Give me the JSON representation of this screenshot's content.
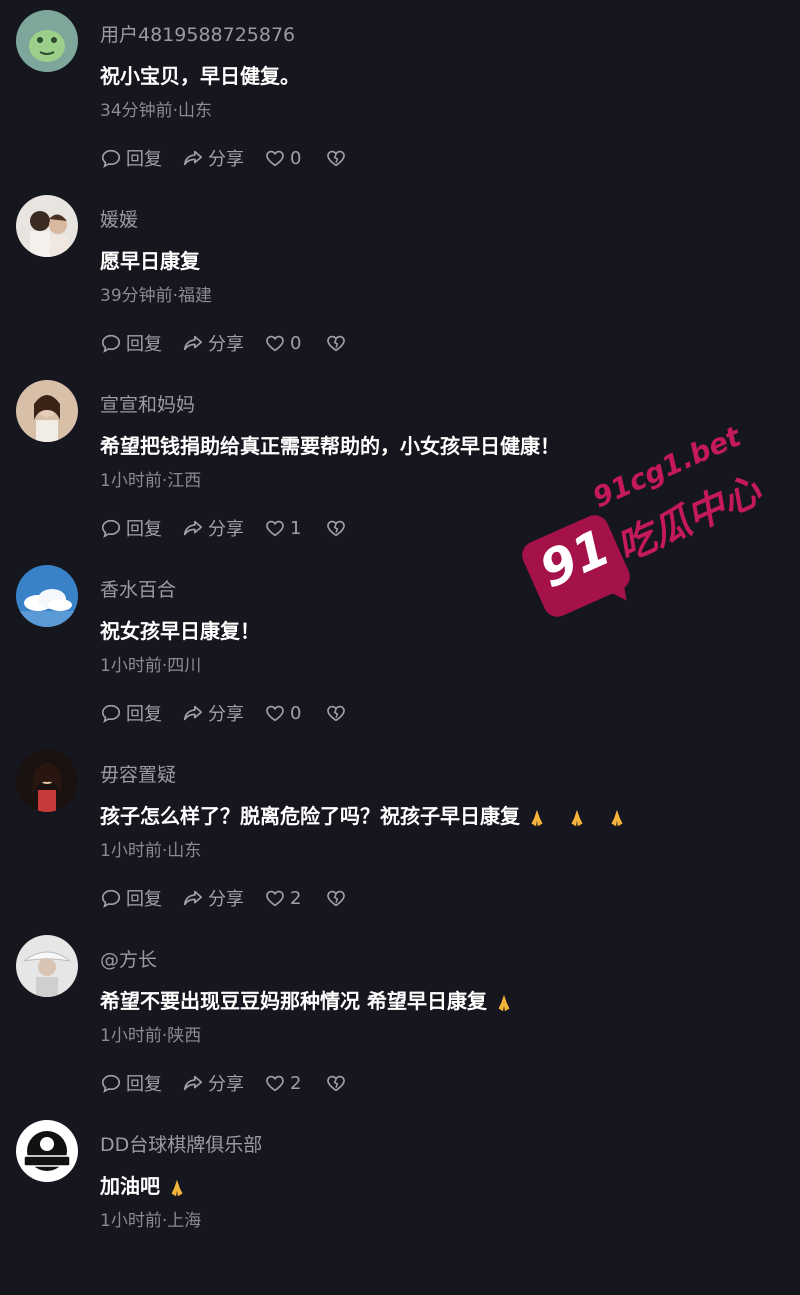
{
  "actions": {
    "reply_label": "回复",
    "share_label": "分享"
  },
  "comments": [
    {
      "user": "用户4819588725876",
      "text": "祝小宝贝，早日健复。",
      "meta": "34分钟前·山东",
      "likes": "0",
      "emojis": 0
    },
    {
      "user": "媛媛",
      "text": "愿早日康复",
      "meta": "39分钟前·福建",
      "likes": "0",
      "emojis": 0
    },
    {
      "user": "宣宣和妈妈",
      "text": "希望把钱捐助给真正需要帮助的，小女孩早日健康！",
      "meta": "1小时前·江西",
      "likes": "1",
      "emojis": 0
    },
    {
      "user": "香水百合",
      "text": "祝女孩早日康复！",
      "meta": "1小时前·四川",
      "likes": "0",
      "emojis": 0
    },
    {
      "user": "毋容置疑",
      "text": "孩子怎么样了？脱离危险了吗？祝孩子早日康复",
      "meta": "1小时前·山东",
      "likes": "2",
      "emojis": 3
    },
    {
      "user": "@方长",
      "text": "希望不要出现豆豆妈那种情况 希望早日康复",
      "meta": "1小时前·陕西",
      "likes": "2",
      "emojis": 1
    },
    {
      "user": "DD台球棋牌俱乐部",
      "text": "加油吧",
      "meta": "1小时前·上海",
      "likes": "",
      "emojis": 1
    }
  ],
  "watermark": {
    "number": "91",
    "domain": "91cg1.bet",
    "name": "吃瓜中心"
  },
  "colors": {
    "background": "#16161f",
    "watermark": "#c51a5a"
  }
}
